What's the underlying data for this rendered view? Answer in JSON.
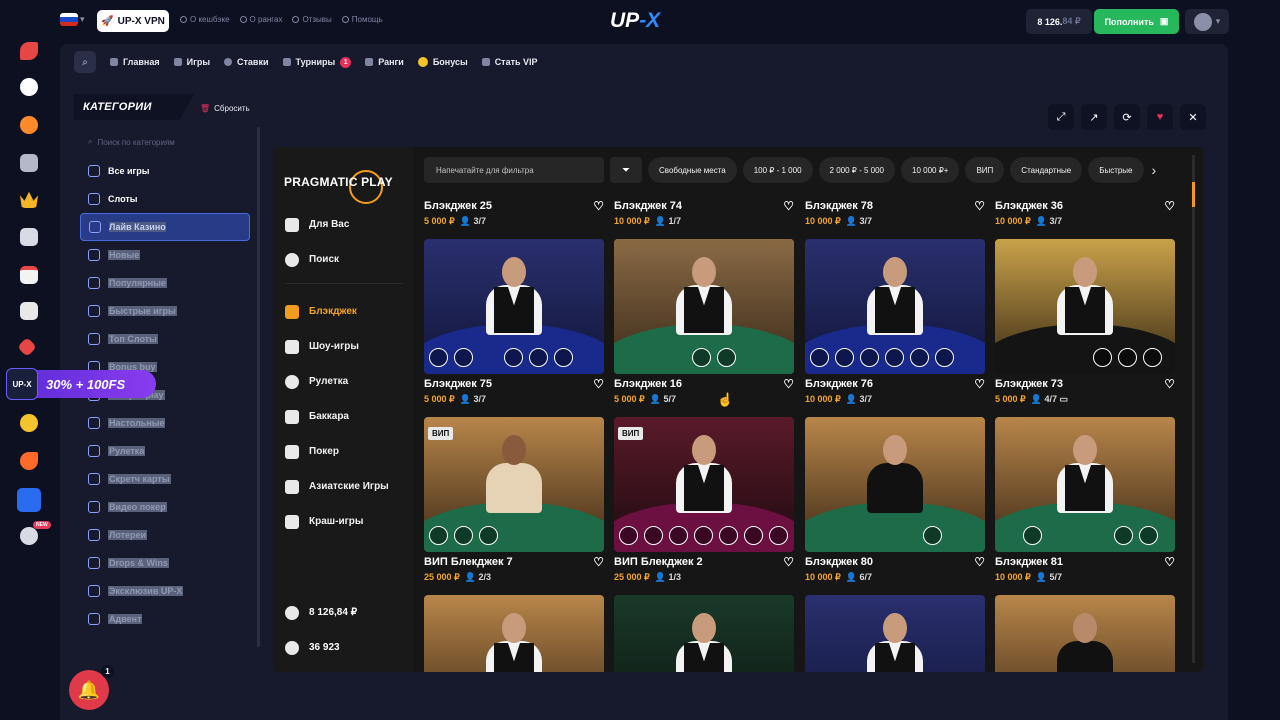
{
  "header": {
    "vpn_label": "UP-X VPN",
    "links": [
      "О кешбэке",
      "О рангах",
      "Отзывы",
      "Помощь"
    ],
    "logo_up": "UP",
    "logo_x": "-X",
    "balance_main": "8 126.",
    "balance_dim": "84 ₽",
    "deposit_label": "Пополнить"
  },
  "nav": {
    "items": [
      {
        "label": "Главная"
      },
      {
        "label": "Игры"
      },
      {
        "label": "Ставки"
      },
      {
        "label": "Турниры",
        "badge": "1"
      },
      {
        "label": "Ранги"
      },
      {
        "label": "Бонусы"
      },
      {
        "label": "Стать VIP"
      }
    ]
  },
  "categories": {
    "title": "КАТЕГОРИИ",
    "reset_label": "Сбросить",
    "search_placeholder": "Поиск по категориям",
    "items": [
      {
        "label": "Все игры"
      },
      {
        "label": "Слоты"
      },
      {
        "label": "Лайв Казино"
      },
      {
        "label": "Новые"
      },
      {
        "label": "Популярные"
      },
      {
        "label": "Быстрые игры"
      },
      {
        "label": "Топ Слоты"
      },
      {
        "label": "Bonus buy"
      },
      {
        "label": "Jackpot play"
      },
      {
        "label": "Настольные"
      },
      {
        "label": "Рулетка"
      },
      {
        "label": "Скретч карты"
      },
      {
        "label": "Видео покер"
      },
      {
        "label": "Лотереи"
      },
      {
        "label": "Drops & Wins"
      },
      {
        "label": "Эксклюзив UP-X"
      },
      {
        "label": "Адвент"
      }
    ]
  },
  "promo": {
    "tile": "UP-X",
    "text": "30% + 100FS",
    "new_badge": "NEW"
  },
  "notifications": {
    "count": "1"
  },
  "provider": {
    "logo_text": "PRAGMATIC PLAY",
    "menu": [
      {
        "label": "Для Вас"
      },
      {
        "label": "Поиск"
      },
      {
        "label": "Блэкджек"
      },
      {
        "label": "Шоу-игры"
      },
      {
        "label": "Рулетка"
      },
      {
        "label": "Баккара"
      },
      {
        "label": "Покер"
      },
      {
        "label": "Азиатские Игры"
      },
      {
        "label": "Краш-игры"
      }
    ],
    "balance": "8 126,84 ₽",
    "players": "36 923"
  },
  "filters": {
    "placeholder": "Напечатайте для фильтра",
    "chips": [
      "Свободные места",
      "100 ₽ - 1 000",
      "2 000 ₽ - 5 000",
      "10 000 ₽+",
      "ВИП",
      "Стандартные",
      "Быстрые"
    ]
  },
  "games": {
    "top_row": [
      {
        "title": "Блэкджек 25",
        "bet": "5 000 ₽",
        "seats": "3/7"
      },
      {
        "title": "Блэкджек 74",
        "bet": "10 000 ₽",
        "seats": "1/7"
      },
      {
        "title": "Блэкджек 78",
        "bet": "10 000 ₽",
        "seats": "3/7"
      },
      {
        "title": "Блэкджек 36",
        "bet": "10 000 ₽",
        "seats": "3/7"
      }
    ],
    "row2": [
      {
        "title": "Блэкджек 75",
        "bet": "5 000 ₽",
        "seats": "3/7"
      },
      {
        "title": "Блэкджек 16",
        "bet": "5 000 ₽",
        "seats": "5/7"
      },
      {
        "title": "Блэкджек 76",
        "bet": "10 000 ₽",
        "seats": "3/7"
      },
      {
        "title": "Блэкджек 73",
        "bet": "5 000 ₽",
        "seats": "4/7"
      }
    ],
    "row3": [
      {
        "title": "ВИП Блекджек 7",
        "bet": "25 000 ₽",
        "seats": "2/3",
        "tag": "ВИП"
      },
      {
        "title": "ВИП Блекджек 2",
        "bet": "25 000 ₽",
        "seats": "1/3",
        "tag": "ВИП"
      },
      {
        "title": "Блэкджек 80",
        "bet": "10 000 ₽",
        "seats": "6/7"
      },
      {
        "title": "Блэкджек 81",
        "bet": "10 000 ₽",
        "seats": "5/7"
      }
    ]
  },
  "colors": {
    "accent": "#f29b1e",
    "deposit": "#27b85e",
    "brand_blue": "#2f8cff"
  }
}
